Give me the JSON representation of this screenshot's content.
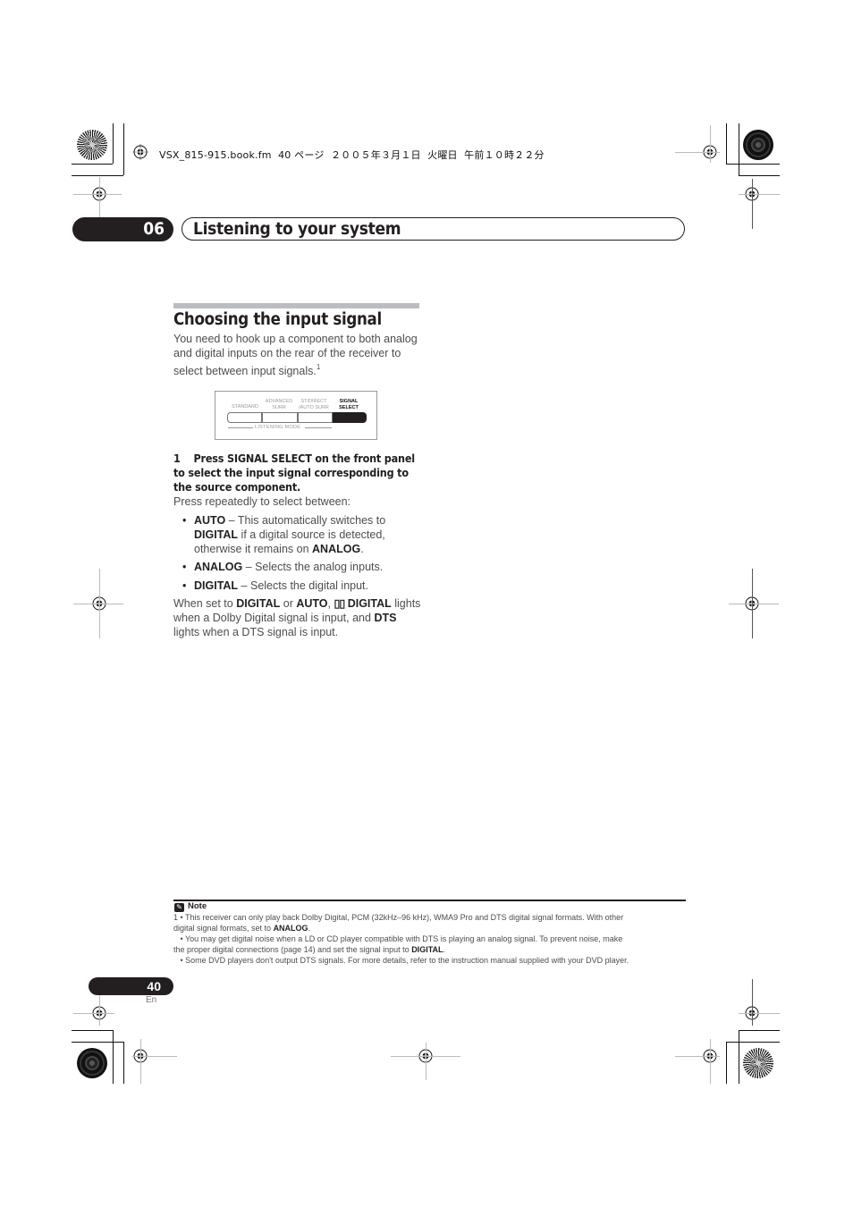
{
  "file_header": "VSX_815-915.book.fm  40 ページ  ２００５年３月１日  火曜日  午前１０時２２分",
  "chapter": {
    "number": "06",
    "title": "Listening to your system"
  },
  "section": {
    "title": "Choosing the input signal",
    "intro": "You need to hook up a component to both analog and digital inputs on the rear of the receiver to select between input signals.",
    "intro_footnote": "1"
  },
  "panel": {
    "buttons": [
      {
        "label": "STANDARD",
        "selected": false
      },
      {
        "label": "ADVANCED SURR",
        "selected": false
      },
      {
        "label": "ST/DIRECT /AUTO SURR",
        "selected": false
      },
      {
        "label": "SIGNAL SELECT",
        "selected": true
      }
    ],
    "labels": {
      "standard": "STANDARD",
      "advanced_1": "ADVANCED",
      "advanced_2": "SURR",
      "stdirect_1": "ST/DIRECT",
      "stdirect_2": "/AUTO SURR",
      "signal_1": "SIGNAL",
      "signal_2": "SELECT"
    },
    "group_label": "LISTENING MODE"
  },
  "step": {
    "number": "1",
    "text": "Press SIGNAL SELECT on the front panel to select the input signal corresponding to the source component.",
    "sub": "Press repeatedly to select between:"
  },
  "options": [
    {
      "name": "AUTO",
      "desc_a": " – This automatically switches to ",
      "bold_b": "DIGITAL",
      "desc_c": " if a digital source is detected, otherwise it remains on ",
      "bold_d": "ANALOG",
      "desc_e": "."
    },
    {
      "name": "ANALOG",
      "desc": " – Selects the analog inputs."
    },
    {
      "name": "DIGITAL",
      "desc": " – Selects the digital input."
    }
  ],
  "closing": {
    "t1": "When set to ",
    "b1": "DIGITAL",
    "t2": " or ",
    "b2": "AUTO",
    "t3": ", ",
    "dolby_symbol": "DD",
    "b3": " DIGITAL",
    "t4": " lights when a Dolby Digital signal is input, and ",
    "b4": "DTS",
    "t5": " lights when a DTS signal is input."
  },
  "note": {
    "label": "Note",
    "lines": [
      {
        "pre": "1  • This receiver can only play back Dolby Digital, PCM (32kHz–96 kHz), WMA9 Pro and DTS digital signal formats. With other",
        "bold": "",
        "post": ""
      },
      {
        "pre": "digital signal formats, set to ",
        "bold": "ANALOG",
        "post": "."
      },
      {
        "pre": "   • You may get digital noise when a LD or CD player compatible with DTS is playing an analog signal. To prevent noise, make",
        "bold": "",
        "post": ""
      },
      {
        "pre": "the proper digital connections (page 14) and set the signal input to ",
        "bold": "DIGITAL",
        "post": "."
      },
      {
        "pre": "   • Some DVD players don't output DTS signals. For more details, refer to the instruction manual supplied with your DVD player.",
        "bold": "",
        "post": ""
      }
    ]
  },
  "footer": {
    "page_number": "40",
    "language": "En"
  }
}
